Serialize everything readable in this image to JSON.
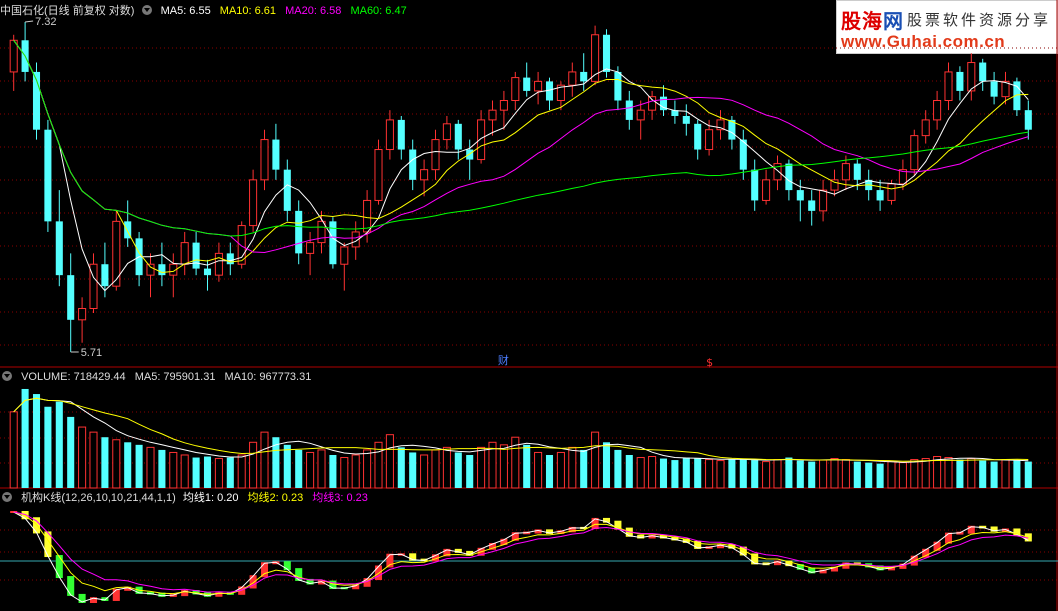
{
  "main_header": {
    "title": "中国石化(日线 前复权 对数)",
    "ma5": "MA5: 6.55",
    "ma10": "MA10: 6.61",
    "ma20": "MA20: 6.58",
    "ma60": "MA60: 6.47"
  },
  "price_labels": {
    "high": "7.32",
    "low": "5.71"
  },
  "markers": {
    "cai": "财",
    "dollar": "$"
  },
  "volume_header": {
    "title": "VOLUME: 718429.44",
    "ma5": "MA5: 795901.31",
    "ma10": "MA10: 967773.31"
  },
  "indicator_header": {
    "title": "机构K线(12,26,10,10,21,44,1,1)",
    "line1": "均线1: 0.20",
    "line2": "均线2: 0.23",
    "line3": "均线3: 0.23"
  },
  "logo": {
    "name_red": "股海",
    "name_blue": "网",
    "slogan": "股票软件资源分享",
    "url": "www.Guhai.com.cn"
  },
  "colors": {
    "up": "#ff3232",
    "down": "#54ffff",
    "ma5": "#ffffff",
    "ma10": "#ffff00",
    "ma20": "#ff00ff",
    "ma60": "#00ff00",
    "grid": "#8a0000",
    "separator": "#b00000"
  },
  "chart_data": [
    {
      "type": "candlestick",
      "title": "中国石化(日线 前复权 对数)",
      "series": [
        {
          "name": "MA5",
          "value": 6.55
        },
        {
          "name": "MA10",
          "value": 6.61
        },
        {
          "name": "MA20",
          "value": 6.58
        },
        {
          "name": "MA60",
          "value": 6.47
        }
      ],
      "ylim": [
        5.71,
        7.32
      ],
      "log_scale": true,
      "ohlc": [
        [
          7.05,
          7.25,
          6.95,
          7.22
        ],
        [
          7.22,
          7.32,
          7.0,
          7.05
        ],
        [
          7.05,
          7.1,
          6.7,
          6.75
        ],
        [
          6.75,
          6.8,
          6.25,
          6.3
        ],
        [
          6.3,
          6.45,
          6.0,
          6.05
        ],
        [
          6.05,
          6.15,
          5.71,
          5.85
        ],
        [
          5.85,
          5.95,
          5.75,
          5.9
        ],
        [
          5.9,
          6.15,
          5.88,
          6.1
        ],
        [
          6.1,
          6.2,
          5.95,
          6.0
        ],
        [
          6.0,
          6.35,
          5.98,
          6.3
        ],
        [
          6.3,
          6.4,
          6.18,
          6.22
        ],
        [
          6.22,
          6.25,
          6.0,
          6.05
        ],
        [
          6.05,
          6.15,
          5.95,
          6.1
        ],
        [
          6.1,
          6.2,
          6.0,
          6.05
        ],
        [
          6.05,
          6.15,
          5.95,
          6.1
        ],
        [
          6.1,
          6.25,
          6.05,
          6.2
        ],
        [
          6.2,
          6.25,
          6.05,
          6.08
        ],
        [
          6.08,
          6.12,
          5.98,
          6.05
        ],
        [
          6.05,
          6.2,
          6.02,
          6.15
        ],
        [
          6.15,
          6.2,
          6.05,
          6.1
        ],
        [
          6.1,
          6.3,
          6.08,
          6.28
        ],
        [
          6.28,
          6.55,
          6.25,
          6.5
        ],
        [
          6.5,
          6.75,
          6.45,
          6.7
        ],
        [
          6.7,
          6.78,
          6.5,
          6.55
        ],
        [
          6.55,
          6.6,
          6.3,
          6.35
        ],
        [
          6.35,
          6.4,
          6.1,
          6.15
        ],
        [
          6.15,
          6.25,
          6.05,
          6.2
        ],
        [
          6.2,
          6.35,
          6.15,
          6.3
        ],
        [
          6.3,
          6.32,
          6.08,
          6.1
        ],
        [
          6.1,
          6.2,
          5.98,
          6.18
        ],
        [
          6.18,
          6.3,
          6.12,
          6.25
        ],
        [
          6.25,
          6.45,
          6.2,
          6.4
        ],
        [
          6.4,
          6.7,
          6.38,
          6.65
        ],
        [
          6.65,
          6.85,
          6.6,
          6.8
        ],
        [
          6.8,
          6.82,
          6.6,
          6.65
        ],
        [
          6.65,
          6.7,
          6.45,
          6.5
        ],
        [
          6.5,
          6.6,
          6.42,
          6.55
        ],
        [
          6.55,
          6.75,
          6.5,
          6.7
        ],
        [
          6.7,
          6.82,
          6.65,
          6.78
        ],
        [
          6.78,
          6.8,
          6.6,
          6.65
        ],
        [
          6.65,
          6.7,
          6.5,
          6.6
        ],
        [
          6.6,
          6.85,
          6.58,
          6.8
        ],
        [
          6.8,
          6.9,
          6.72,
          6.85
        ],
        [
          6.85,
          6.95,
          6.75,
          6.9
        ],
        [
          6.9,
          7.05,
          6.85,
          7.02
        ],
        [
          7.02,
          7.1,
          6.92,
          6.95
        ],
        [
          6.95,
          7.05,
          6.88,
          7.0
        ],
        [
          7.0,
          7.02,
          6.85,
          6.9
        ],
        [
          6.9,
          7.0,
          6.85,
          6.98
        ],
        [
          6.98,
          7.1,
          6.92,
          7.05
        ],
        [
          7.05,
          7.15,
          6.95,
          7.0
        ],
        [
          7.0,
          7.3,
          6.98,
          7.25
        ],
        [
          7.25,
          7.28,
          7.02,
          7.05
        ],
        [
          7.05,
          7.08,
          6.85,
          6.9
        ],
        [
          6.9,
          6.95,
          6.75,
          6.8
        ],
        [
          6.8,
          6.9,
          6.7,
          6.85
        ],
        [
          6.85,
          6.95,
          6.8,
          6.92
        ],
        [
          6.92,
          6.98,
          6.82,
          6.85
        ],
        [
          6.85,
          6.9,
          6.78,
          6.82
        ],
        [
          6.82,
          6.88,
          6.72,
          6.78
        ],
        [
          6.78,
          6.8,
          6.6,
          6.65
        ],
        [
          6.65,
          6.8,
          6.62,
          6.75
        ],
        [
          6.75,
          6.85,
          6.7,
          6.8
        ],
        [
          6.8,
          6.82,
          6.65,
          6.7
        ],
        [
          6.7,
          6.75,
          6.5,
          6.55
        ],
        [
          6.55,
          6.6,
          6.35,
          6.4
        ],
        [
          6.4,
          6.55,
          6.38,
          6.5
        ],
        [
          6.5,
          6.62,
          6.45,
          6.58
        ],
        [
          6.58,
          6.6,
          6.4,
          6.45
        ],
        [
          6.45,
          6.5,
          6.3,
          6.4
        ],
        [
          6.4,
          6.45,
          6.28,
          6.35
        ],
        [
          6.35,
          6.5,
          6.3,
          6.45
        ],
        [
          6.45,
          6.55,
          6.42,
          6.5
        ],
        [
          6.5,
          6.62,
          6.45,
          6.58
        ],
        [
          6.58,
          6.6,
          6.45,
          6.5
        ],
        [
          6.5,
          6.55,
          6.4,
          6.45
        ],
        [
          6.45,
          6.5,
          6.35,
          6.4
        ],
        [
          6.4,
          6.5,
          6.38,
          6.48
        ],
        [
          6.48,
          6.6,
          6.45,
          6.55
        ],
        [
          6.55,
          6.75,
          6.52,
          6.72
        ],
        [
          6.72,
          6.85,
          6.68,
          6.8
        ],
        [
          6.8,
          6.95,
          6.75,
          6.9
        ],
        [
          6.9,
          7.1,
          6.85,
          7.05
        ],
        [
          7.05,
          7.08,
          6.9,
          6.95
        ],
        [
          6.95,
          7.15,
          6.9,
          7.1
        ],
        [
          7.1,
          7.12,
          6.95,
          7.0
        ],
        [
          7.0,
          7.05,
          6.88,
          6.92
        ],
        [
          6.92,
          7.05,
          6.88,
          7.0
        ],
        [
          7.0,
          7.02,
          6.82,
          6.85
        ],
        [
          6.85,
          6.9,
          6.7,
          6.75
        ]
      ],
      "volume": {
        "title": "VOLUME: 718429.44",
        "ma5": 795901.31,
        "ma10": 967773.31,
        "values": [
          1500000,
          1950000,
          1850000,
          1600000,
          1700000,
          1400000,
          1200000,
          1100000,
          1000000,
          950000,
          900000,
          850000,
          800000,
          750000,
          700000,
          650000,
          600000,
          620000,
          580000,
          600000,
          650000,
          900000,
          1100000,
          1000000,
          850000,
          750000,
          700000,
          750000,
          650000,
          600000,
          650000,
          750000,
          900000,
          1050000,
          800000,
          700000,
          650000,
          750000,
          800000,
          700000,
          650000,
          800000,
          900000,
          850000,
          1000000,
          850000,
          700000,
          650000,
          700000,
          800000,
          750000,
          1100000,
          900000,
          750000,
          650000,
          600000,
          620000,
          580000,
          550000,
          600000,
          580000,
          560000,
          540000,
          560000,
          580000,
          550000,
          520000,
          560000,
          600000,
          540000,
          520000,
          550000,
          580000,
          560000,
          520000,
          500000,
          480000,
          520000,
          500000,
          560000,
          580000,
          620000,
          600000,
          560000,
          580000,
          540000,
          520000,
          560000,
          540000,
          520000
        ]
      },
      "indicator": {
        "title": "机构K线(12,26,10,10,21,44,1,1)",
        "line1": 0.2,
        "line2": 0.23,
        "line3": 0.23
      }
    }
  ]
}
